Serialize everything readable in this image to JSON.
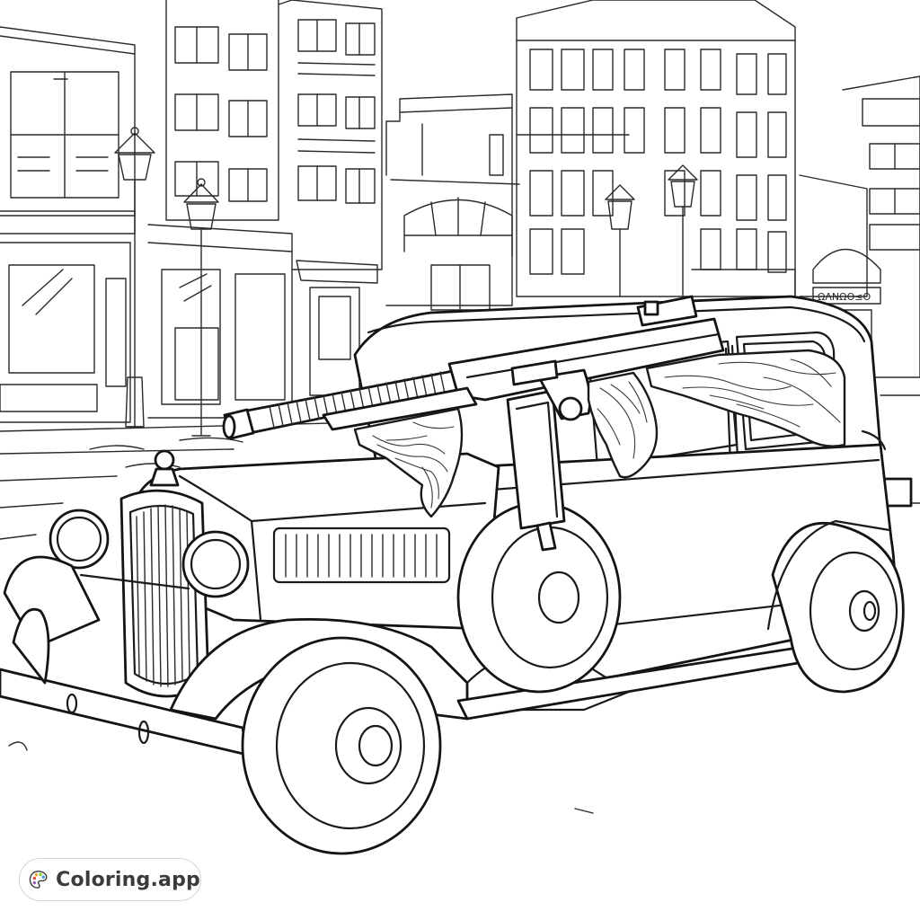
{
  "artwork": {
    "subject_icon": "coloring-page-line-art",
    "shop_sign_text": "ΩΛΝΩΟ≤Ο",
    "line_color": "#1a1a1a",
    "background_color": "#ffffff"
  },
  "watermark": {
    "logo_icon": "palette-icon",
    "brand_text": "Coloring.app",
    "palette_colors": [
      "#e94b3c",
      "#f5a623",
      "#7ed321",
      "#4a90e2",
      "#9b59b6"
    ]
  }
}
